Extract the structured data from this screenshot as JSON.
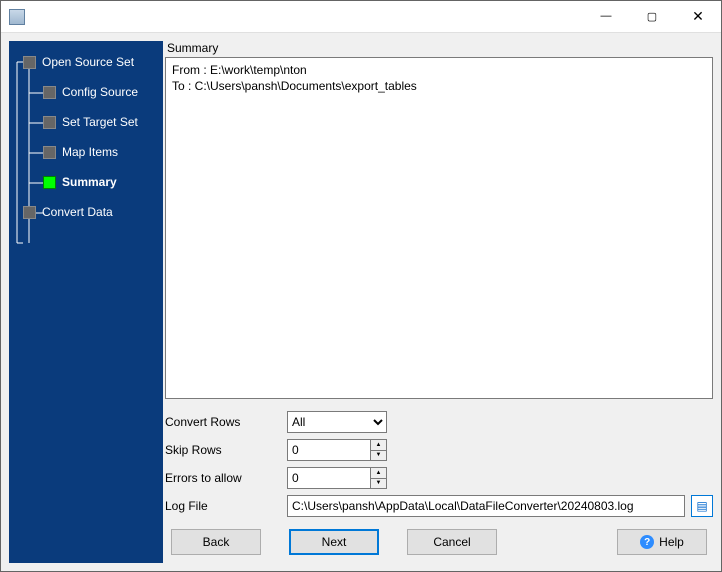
{
  "titlebar": {
    "min": "—",
    "max": "▢",
    "close": "✕"
  },
  "sidebar": {
    "items": [
      {
        "label": "Open Source Set"
      },
      {
        "label": "Config Source"
      },
      {
        "label": "Set Target Set"
      },
      {
        "label": "Map Items"
      },
      {
        "label": "Summary"
      },
      {
        "label": "Convert Data"
      }
    ]
  },
  "panel": {
    "title": "Summary",
    "text": "From : E:\\work\\temp\\nton\nTo : C:\\Users\\pansh\\Documents\\export_tables"
  },
  "form": {
    "convert_rows": {
      "label": "Convert Rows",
      "value": "All"
    },
    "skip_rows": {
      "label": "Skip Rows",
      "value": "0"
    },
    "errors": {
      "label": "Errors to allow",
      "value": "0"
    },
    "log_file": {
      "label": "Log File",
      "value": "C:\\Users\\pansh\\AppData\\Local\\DataFileConverter\\20240803.log"
    }
  },
  "nav": {
    "back": "Back",
    "next": "Next",
    "cancel": "Cancel",
    "help": "Help"
  }
}
